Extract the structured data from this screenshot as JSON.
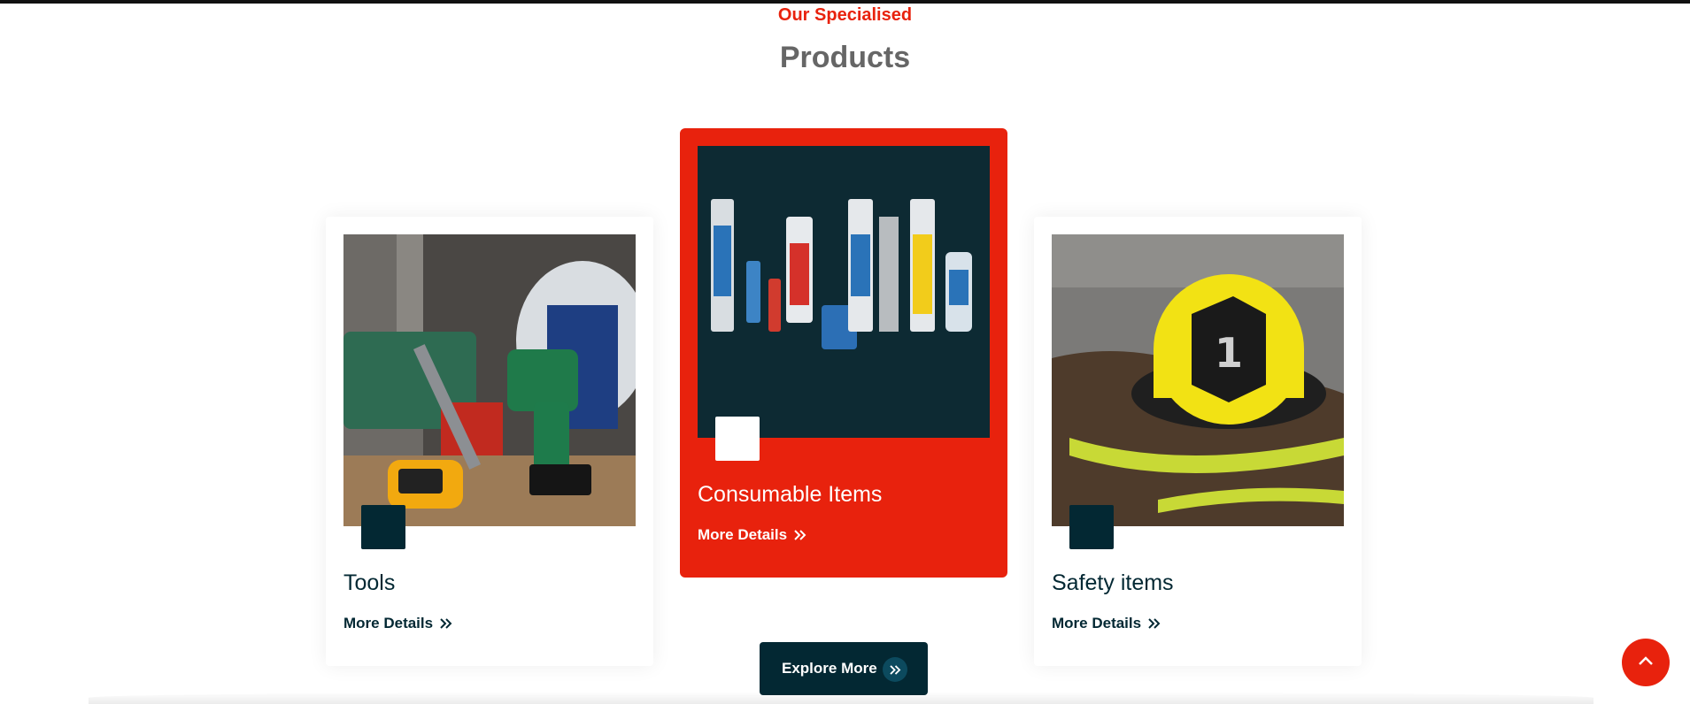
{
  "section": {
    "subtitle": "Our Specialised",
    "title": "Products"
  },
  "cards": [
    {
      "title": "Tools",
      "link_label": "More Details",
      "image": "power-tools-photo",
      "active": false
    },
    {
      "title": "Consumable Items",
      "link_label": "More Details",
      "image": "adhesive-tubes-photo",
      "active": true
    },
    {
      "title": "Safety items",
      "link_label": "More Details",
      "image": "firefighter-helmet-photo",
      "active": false
    }
  ],
  "explore_button": {
    "label": "Explore More",
    "icon": "double-chevron-right-icon"
  },
  "scroll_top_button": {
    "icon": "chevron-up-icon"
  },
  "colors": {
    "accent": "#e8220d",
    "dark": "#032833",
    "heading_gray": "#666666"
  }
}
